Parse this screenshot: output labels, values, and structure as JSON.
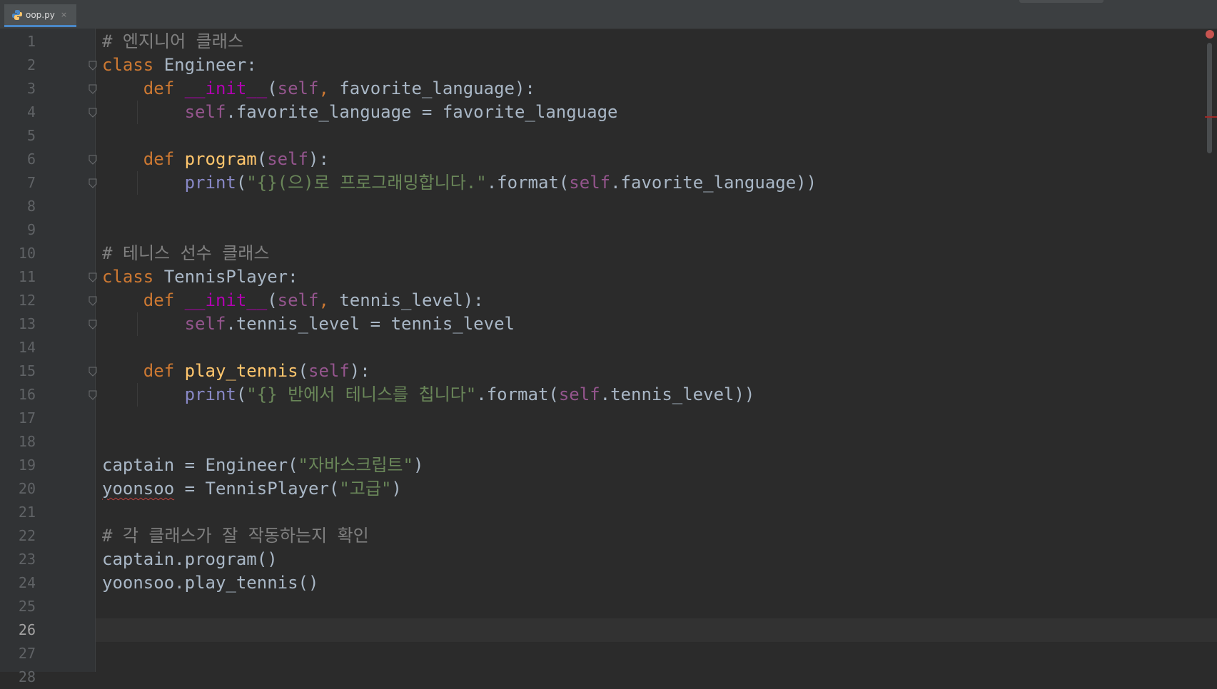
{
  "tab": {
    "filename": "oop.py",
    "close": "×"
  },
  "editor": {
    "current_line": 26,
    "line_numbers": [
      "1",
      "2",
      "3",
      "4",
      "5",
      "6",
      "7",
      "8",
      "9",
      "10",
      "11",
      "12",
      "13",
      "14",
      "15",
      "16",
      "17",
      "18",
      "19",
      "20",
      "21",
      "22",
      "23",
      "24",
      "25",
      "26",
      "27",
      "28"
    ],
    "lines": [
      [
        [
          "cmt",
          "# 엔지니어 클래스"
        ]
      ],
      [
        [
          "kw",
          "class "
        ],
        [
          "",
          "Engineer:"
        ]
      ],
      [
        [
          "",
          "    "
        ],
        [
          "kw",
          "def "
        ],
        [
          "mg",
          "__init__"
        ],
        [
          "",
          "("
        ],
        [
          "sf",
          "self"
        ],
        [
          "kw",
          ", "
        ],
        [
          "",
          "favorite_language):"
        ]
      ],
      [
        [
          "",
          "        "
        ],
        [
          "sf",
          "self"
        ],
        [
          "",
          ".favorite_language = favorite_language"
        ]
      ],
      [],
      [
        [
          "",
          "    "
        ],
        [
          "kw",
          "def "
        ],
        [
          "fn",
          "program"
        ],
        [
          "",
          "("
        ],
        [
          "sf",
          "self"
        ],
        [
          "",
          "):"
        ]
      ],
      [
        [
          "",
          "        "
        ],
        [
          "bi",
          "print"
        ],
        [
          "",
          "("
        ],
        [
          "st",
          "\"{}(으)로 프로그래밍합니다.\""
        ],
        [
          "",
          ".format("
        ],
        [
          "sf",
          "self"
        ],
        [
          "",
          ".favorite_language))"
        ]
      ],
      [],
      [],
      [
        [
          "cmt",
          "# 테니스 선수 클래스"
        ]
      ],
      [
        [
          "kw",
          "class "
        ],
        [
          "",
          "TennisPlayer:"
        ]
      ],
      [
        [
          "",
          "    "
        ],
        [
          "kw",
          "def "
        ],
        [
          "mg",
          "__init__"
        ],
        [
          "",
          "("
        ],
        [
          "sf",
          "self"
        ],
        [
          "kw",
          ", "
        ],
        [
          "",
          "tennis_level):"
        ]
      ],
      [
        [
          "",
          "        "
        ],
        [
          "sf",
          "self"
        ],
        [
          "",
          ".tennis_level = tennis_level"
        ]
      ],
      [],
      [
        [
          "",
          "    "
        ],
        [
          "kw",
          "def "
        ],
        [
          "fn",
          "play_tennis"
        ],
        [
          "",
          "("
        ],
        [
          "sf",
          "self"
        ],
        [
          "",
          "):"
        ]
      ],
      [
        [
          "",
          "        "
        ],
        [
          "bi",
          "print"
        ],
        [
          "",
          "("
        ],
        [
          "st",
          "\"{} 반에서 테니스를 칩니다\""
        ],
        [
          "",
          ".format("
        ],
        [
          "sf",
          "self"
        ],
        [
          "",
          ".tennis_level))"
        ]
      ],
      [],
      [],
      [
        [
          "",
          "captain = Engineer("
        ],
        [
          "st",
          "\"자바스크립트\""
        ],
        [
          "",
          ")"
        ]
      ],
      [
        [
          "squiggle",
          "yoonsoo"
        ],
        [
          "",
          " = TennisPlayer("
        ],
        [
          "st",
          "\"고급\""
        ],
        [
          "",
          ")"
        ]
      ],
      [],
      [
        [
          "cmt",
          "# 각 클래스가 잘 작동하는지 확인"
        ]
      ],
      [
        [
          "",
          "captain.program()"
        ]
      ],
      [
        [
          "",
          "yoonsoo.play_tennis()"
        ]
      ],
      [],
      [],
      [],
      []
    ],
    "fold_markers": [
      2,
      3,
      4,
      6,
      7,
      11,
      12,
      13,
      15,
      16
    ]
  },
  "colors": {
    "background": "#2b2b2b",
    "gutter": "#313335",
    "comment": "#808080",
    "keyword": "#cc7832",
    "function": "#ffc66d",
    "magic": "#b200b2",
    "self": "#94558d",
    "string": "#6a8759",
    "builtin": "#8888c6",
    "text": "#a9b7c6"
  },
  "icons": {
    "tab_icon": "python-file-icon",
    "error_marker": "error-dot-icon"
  }
}
